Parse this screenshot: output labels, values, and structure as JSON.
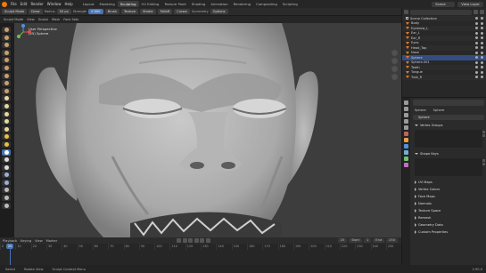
{
  "topbar": {
    "menus": [
      "File",
      "Edit",
      "Render",
      "Window",
      "Help"
    ],
    "workspaces": [
      "Layout",
      "Modeling",
      "Sculpting",
      "UV Editing",
      "Texture Paint",
      "Shading",
      "Animation",
      "Rendering",
      "Compositing",
      "Scripting"
    ],
    "active_workspace": "Sculpting",
    "scene_label": "Scene",
    "view_layer_label": "View Layer"
  },
  "tool_header": {
    "mode": "Sculpt Mode",
    "brush": "Draw",
    "radius_label": "Radius",
    "radius_value": "50 px",
    "strength_label": "Strength",
    "strength_value": "0.500",
    "items": [
      "Brush",
      "Texture",
      "Stroke",
      "Falloff",
      "Cursor"
    ],
    "symmetry_label": "Symmetry",
    "options_label": "Options"
  },
  "view_header": {
    "items": [
      "Sculpt Mode",
      "View",
      "Sculpt",
      "Mask",
      "Face Sets"
    ]
  },
  "viewport": {
    "overlay_line1": "User Perspective",
    "overlay_line2": "(25) Sphere"
  },
  "timeline": {
    "menus": [
      "Playback",
      "Keying",
      "View",
      "Marker"
    ],
    "current_frame": "25",
    "start_label": "Start",
    "start_value": "1",
    "end_label": "End",
    "end_value": "250",
    "ruler": [
      "0",
      "10",
      "20",
      "30",
      "40",
      "50",
      "60",
      "70",
      "80",
      "90",
      "100",
      "110",
      "120",
      "130",
      "140",
      "150",
      "160",
      "170",
      "180",
      "190",
      "200",
      "210",
      "220",
      "230",
      "240",
      "250"
    ]
  },
  "statusbar": {
    "hints": [
      "Select",
      "Rotate View",
      "Sculpt Context Menu"
    ],
    "version": "2.90.0"
  },
  "outliner": {
    "rows": [
      {
        "label": "Scene Collection",
        "kind": "collection"
      },
      {
        "label": "Body",
        "kind": "object"
      },
      {
        "label": "Eyebrow_L",
        "kind": "object"
      },
      {
        "label": "Ear_L",
        "kind": "object"
      },
      {
        "label": "Ear_R",
        "kind": "object"
      },
      {
        "label": "Eyes",
        "kind": "object"
      },
      {
        "label": "Head_Top",
        "kind": "object"
      },
      {
        "label": "Nose",
        "kind": "object"
      },
      {
        "label": "Sphere",
        "kind": "object",
        "selected": true
      },
      {
        "label": "Sphere.001",
        "kind": "object"
      },
      {
        "label": "Teeth",
        "kind": "object"
      },
      {
        "label": "Tongue",
        "kind": "object"
      },
      {
        "label": "Tusk_R",
        "kind": "object"
      }
    ]
  },
  "properties": {
    "breadcrumb": [
      "Sphere",
      "Sphere"
    ],
    "mesh_name": "Sphere",
    "panels": [
      {
        "label": "Vertex Groups",
        "open": true
      },
      {
        "label": "Shape Keys",
        "open": true
      },
      {
        "label": "UV Maps",
        "open": false
      },
      {
        "label": "Vertex Colors",
        "open": false
      },
      {
        "label": "Face Maps",
        "open": false
      },
      {
        "label": "Normals",
        "open": false
      },
      {
        "label": "Texture Space",
        "open": false
      },
      {
        "label": "Remesh",
        "open": false
      },
      {
        "label": "Geometry Data",
        "open": false
      },
      {
        "label": "Custom Properties",
        "open": false
      }
    ]
  },
  "colors": {
    "accent": "#4772b3",
    "blender_orange": "#e87d0d",
    "viewport_bg": "#3d3d3d",
    "clay": "#b9b9b9"
  }
}
